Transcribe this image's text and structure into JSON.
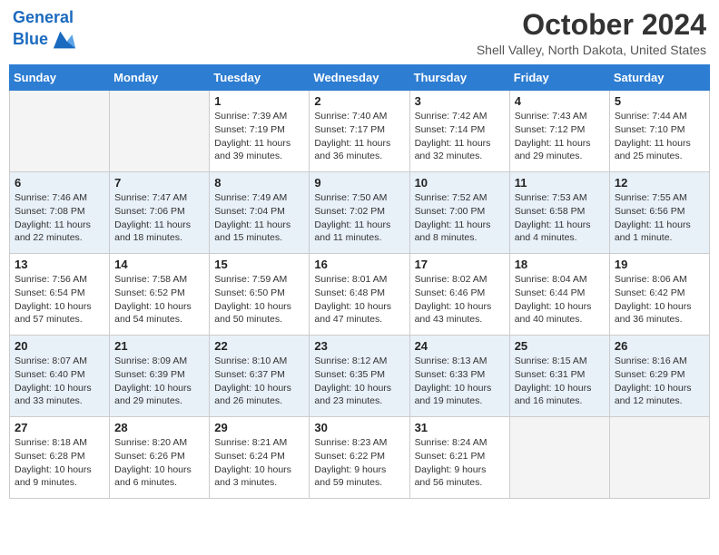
{
  "header": {
    "logo_line1": "General",
    "logo_line2": "Blue",
    "month": "October 2024",
    "location": "Shell Valley, North Dakota, United States"
  },
  "days_of_week": [
    "Sunday",
    "Monday",
    "Tuesday",
    "Wednesday",
    "Thursday",
    "Friday",
    "Saturday"
  ],
  "weeks": [
    [
      {
        "day": "",
        "content": ""
      },
      {
        "day": "",
        "content": ""
      },
      {
        "day": "1",
        "content": "Sunrise: 7:39 AM\nSunset: 7:19 PM\nDaylight: 11 hours and 39 minutes."
      },
      {
        "day": "2",
        "content": "Sunrise: 7:40 AM\nSunset: 7:17 PM\nDaylight: 11 hours and 36 minutes."
      },
      {
        "day": "3",
        "content": "Sunrise: 7:42 AM\nSunset: 7:14 PM\nDaylight: 11 hours and 32 minutes."
      },
      {
        "day": "4",
        "content": "Sunrise: 7:43 AM\nSunset: 7:12 PM\nDaylight: 11 hours and 29 minutes."
      },
      {
        "day": "5",
        "content": "Sunrise: 7:44 AM\nSunset: 7:10 PM\nDaylight: 11 hours and 25 minutes."
      }
    ],
    [
      {
        "day": "6",
        "content": "Sunrise: 7:46 AM\nSunset: 7:08 PM\nDaylight: 11 hours and 22 minutes."
      },
      {
        "day": "7",
        "content": "Sunrise: 7:47 AM\nSunset: 7:06 PM\nDaylight: 11 hours and 18 minutes."
      },
      {
        "day": "8",
        "content": "Sunrise: 7:49 AM\nSunset: 7:04 PM\nDaylight: 11 hours and 15 minutes."
      },
      {
        "day": "9",
        "content": "Sunrise: 7:50 AM\nSunset: 7:02 PM\nDaylight: 11 hours and 11 minutes."
      },
      {
        "day": "10",
        "content": "Sunrise: 7:52 AM\nSunset: 7:00 PM\nDaylight: 11 hours and 8 minutes."
      },
      {
        "day": "11",
        "content": "Sunrise: 7:53 AM\nSunset: 6:58 PM\nDaylight: 11 hours and 4 minutes."
      },
      {
        "day": "12",
        "content": "Sunrise: 7:55 AM\nSunset: 6:56 PM\nDaylight: 11 hours and 1 minute."
      }
    ],
    [
      {
        "day": "13",
        "content": "Sunrise: 7:56 AM\nSunset: 6:54 PM\nDaylight: 10 hours and 57 minutes."
      },
      {
        "day": "14",
        "content": "Sunrise: 7:58 AM\nSunset: 6:52 PM\nDaylight: 10 hours and 54 minutes."
      },
      {
        "day": "15",
        "content": "Sunrise: 7:59 AM\nSunset: 6:50 PM\nDaylight: 10 hours and 50 minutes."
      },
      {
        "day": "16",
        "content": "Sunrise: 8:01 AM\nSunset: 6:48 PM\nDaylight: 10 hours and 47 minutes."
      },
      {
        "day": "17",
        "content": "Sunrise: 8:02 AM\nSunset: 6:46 PM\nDaylight: 10 hours and 43 minutes."
      },
      {
        "day": "18",
        "content": "Sunrise: 8:04 AM\nSunset: 6:44 PM\nDaylight: 10 hours and 40 minutes."
      },
      {
        "day": "19",
        "content": "Sunrise: 8:06 AM\nSunset: 6:42 PM\nDaylight: 10 hours and 36 minutes."
      }
    ],
    [
      {
        "day": "20",
        "content": "Sunrise: 8:07 AM\nSunset: 6:40 PM\nDaylight: 10 hours and 33 minutes."
      },
      {
        "day": "21",
        "content": "Sunrise: 8:09 AM\nSunset: 6:39 PM\nDaylight: 10 hours and 29 minutes."
      },
      {
        "day": "22",
        "content": "Sunrise: 8:10 AM\nSunset: 6:37 PM\nDaylight: 10 hours and 26 minutes."
      },
      {
        "day": "23",
        "content": "Sunrise: 8:12 AM\nSunset: 6:35 PM\nDaylight: 10 hours and 23 minutes."
      },
      {
        "day": "24",
        "content": "Sunrise: 8:13 AM\nSunset: 6:33 PM\nDaylight: 10 hours and 19 minutes."
      },
      {
        "day": "25",
        "content": "Sunrise: 8:15 AM\nSunset: 6:31 PM\nDaylight: 10 hours and 16 minutes."
      },
      {
        "day": "26",
        "content": "Sunrise: 8:16 AM\nSunset: 6:29 PM\nDaylight: 10 hours and 12 minutes."
      }
    ],
    [
      {
        "day": "27",
        "content": "Sunrise: 8:18 AM\nSunset: 6:28 PM\nDaylight: 10 hours and 9 minutes."
      },
      {
        "day": "28",
        "content": "Sunrise: 8:20 AM\nSunset: 6:26 PM\nDaylight: 10 hours and 6 minutes."
      },
      {
        "day": "29",
        "content": "Sunrise: 8:21 AM\nSunset: 6:24 PM\nDaylight: 10 hours and 3 minutes."
      },
      {
        "day": "30",
        "content": "Sunrise: 8:23 AM\nSunset: 6:22 PM\nDaylight: 9 hours and 59 minutes."
      },
      {
        "day": "31",
        "content": "Sunrise: 8:24 AM\nSunset: 6:21 PM\nDaylight: 9 hours and 56 minutes."
      },
      {
        "day": "",
        "content": ""
      },
      {
        "day": "",
        "content": ""
      }
    ]
  ],
  "week_row_classes": [
    "week-row-1",
    "week-row-2",
    "week-row-3",
    "week-row-4",
    "week-row-5"
  ]
}
